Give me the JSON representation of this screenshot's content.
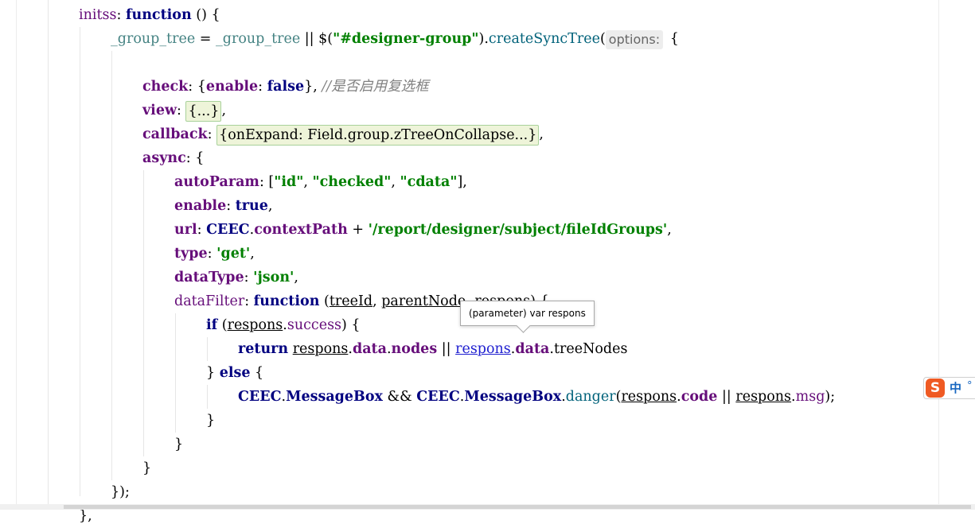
{
  "editor": {
    "lines": [
      [
        {
          "t": "initss",
          "c": "prop-plain"
        },
        {
          "t": ": ",
          "c": "plain"
        },
        {
          "t": "function",
          "c": "kw"
        },
        {
          "t": " () {",
          "c": "plain"
        }
      ],
      [
        {
          "t": "_group_tree",
          "c": "ident"
        },
        {
          "t": " = ",
          "c": "plain"
        },
        {
          "t": "_group_tree",
          "c": "ident"
        },
        {
          "t": " || ",
          "c": "plain"
        },
        {
          "t": "$",
          "c": "plain"
        },
        {
          "t": "(",
          "c": "plain"
        },
        {
          "t": "\"#designer-group\"",
          "c": "str"
        },
        {
          "t": ").",
          "c": "plain"
        },
        {
          "t": "createSyncTree",
          "c": "fnname"
        },
        {
          "t": "(",
          "c": "plain"
        }
      ],
      [],
      [
        {
          "t": "check",
          "c": "prop"
        },
        {
          "t": ": {",
          "c": "plain"
        },
        {
          "t": "enable",
          "c": "prop"
        },
        {
          "t": ": ",
          "c": "plain"
        },
        {
          "t": "false",
          "c": "kw"
        },
        {
          "t": "}, ",
          "c": "plain"
        },
        {
          "t": "//是否启用复选框",
          "c": "cmt"
        }
      ],
      [
        {
          "t": "view",
          "c": "prop"
        },
        {
          "t": ": ",
          "c": "plain"
        }
      ],
      [
        {
          "t": "callback",
          "c": "prop"
        },
        {
          "t": ": ",
          "c": "plain"
        }
      ],
      [
        {
          "t": "async",
          "c": "prop"
        },
        {
          "t": ": {",
          "c": "plain"
        }
      ],
      [
        {
          "t": "autoParam",
          "c": "prop"
        },
        {
          "t": ": [",
          "c": "plain"
        },
        {
          "t": "\"id\"",
          "c": "str"
        },
        {
          "t": ", ",
          "c": "plain"
        },
        {
          "t": "\"checked\"",
          "c": "str"
        },
        {
          "t": ", ",
          "c": "plain"
        },
        {
          "t": "\"cdata\"",
          "c": "str"
        },
        {
          "t": "],",
          "c": "plain"
        }
      ],
      [
        {
          "t": "enable",
          "c": "prop"
        },
        {
          "t": ": ",
          "c": "plain"
        },
        {
          "t": "true",
          "c": "kw"
        },
        {
          "t": ",",
          "c": "plain"
        }
      ],
      [
        {
          "t": "url",
          "c": "prop"
        },
        {
          "t": ": ",
          "c": "plain"
        },
        {
          "t": "CEEC",
          "c": "kw"
        },
        {
          "t": ".",
          "c": "plain"
        },
        {
          "t": "contextPath",
          "c": "prop"
        },
        {
          "t": " + ",
          "c": "plain"
        },
        {
          "t": "'/report/designer/subject/fileIdGroups'",
          "c": "str"
        },
        {
          "t": ",",
          "c": "plain"
        }
      ],
      [
        {
          "t": "type",
          "c": "prop"
        },
        {
          "t": ": ",
          "c": "plain"
        },
        {
          "t": "'get'",
          "c": "str"
        },
        {
          "t": ",",
          "c": "plain"
        }
      ],
      [
        {
          "t": "dataType",
          "c": "prop"
        },
        {
          "t": ": ",
          "c": "plain"
        },
        {
          "t": "'json'",
          "c": "str"
        },
        {
          "t": ",",
          "c": "plain"
        }
      ],
      [
        {
          "t": "dataFilter",
          "c": "prop-plain"
        },
        {
          "t": ": ",
          "c": "plain"
        },
        {
          "t": "function",
          "c": "kw"
        },
        {
          "t": " (",
          "c": "plain"
        },
        {
          "t": "treeId",
          "c": "ul"
        },
        {
          "t": ", ",
          "c": "plain"
        },
        {
          "t": "parentNode",
          "c": "ul"
        },
        {
          "t": ", ",
          "c": "plain"
        },
        {
          "t": "respons",
          "c": "ul"
        },
        {
          "t": ") {",
          "c": "plain"
        }
      ],
      [
        {
          "t": "if",
          "c": "kw"
        },
        {
          "t": " (",
          "c": "plain"
        },
        {
          "t": "respons",
          "c": "ul"
        },
        {
          "t": ".",
          "c": "plain"
        },
        {
          "t": "success",
          "c": "prop-plain"
        },
        {
          "t": ") {",
          "c": "plain"
        }
      ],
      [
        {
          "t": "return",
          "c": "kw"
        },
        {
          "t": " ",
          "c": "plain"
        },
        {
          "t": "respons",
          "c": "ul"
        },
        {
          "t": ".",
          "c": "plain"
        },
        {
          "t": "data",
          "c": "prop"
        },
        {
          "t": ".",
          "c": "plain"
        },
        {
          "t": "nodes",
          "c": "prop"
        },
        {
          "t": " || ",
          "c": "plain"
        },
        {
          "t": "respons",
          "c": "link"
        },
        {
          "t": ".",
          "c": "plain"
        },
        {
          "t": "data",
          "c": "prop"
        },
        {
          "t": ".",
          "c": "plain"
        },
        {
          "t": "treeNodes",
          "c": "method"
        }
      ],
      [
        {
          "t": "} ",
          "c": "plain"
        },
        {
          "t": "else",
          "c": "kw"
        },
        {
          "t": " {",
          "c": "plain"
        }
      ],
      [
        {
          "t": "CEEC",
          "c": "kw"
        },
        {
          "t": ".",
          "c": "plain"
        },
        {
          "t": "MessageBox",
          "c": "kw"
        },
        {
          "t": " && ",
          "c": "plain"
        },
        {
          "t": "CEEC",
          "c": "kw"
        },
        {
          "t": ".",
          "c": "plain"
        },
        {
          "t": "MessageBox",
          "c": "kw"
        },
        {
          "t": ".",
          "c": "plain"
        },
        {
          "t": "danger",
          "c": "fnname"
        },
        {
          "t": "(",
          "c": "plain"
        },
        {
          "t": "respons",
          "c": "ul"
        },
        {
          "t": ".",
          "c": "plain"
        },
        {
          "t": "code",
          "c": "prop"
        },
        {
          "t": " || ",
          "c": "plain"
        },
        {
          "t": "respons",
          "c": "ul"
        },
        {
          "t": ".",
          "c": "plain"
        },
        {
          "t": "msg",
          "c": "prop-plain"
        },
        {
          "t": ");",
          "c": "plain"
        }
      ],
      [
        {
          "t": "}",
          "c": "plain"
        }
      ],
      [
        {
          "t": "}",
          "c": "plain"
        }
      ],
      [
        {
          "t": "}",
          "c": "plain"
        }
      ],
      [
        {
          "t": "});",
          "c": "plain"
        }
      ],
      [
        {
          "t": "},",
          "c": "plain"
        }
      ]
    ],
    "param_hint": "options:",
    "param_hint_tail": " {",
    "fold_view": "{...}",
    "fold_view_tail": ",",
    "fold_callback": "{onExpand: Field.group.zTreeOnCollapse...}",
    "fold_callback_tail": ","
  },
  "tooltip": {
    "text": "(parameter) var respons"
  },
  "ime": {
    "logo": "S",
    "mode": "中",
    "punct": "°"
  },
  "colors": {
    "keyword": "#000080",
    "property": "#660e7a",
    "string": "#008000",
    "comment": "#808080",
    "identifier": "#458383",
    "fold_bg": "#eef4d9",
    "fold_border": "#a8d19a",
    "link": "#2020d0"
  }
}
